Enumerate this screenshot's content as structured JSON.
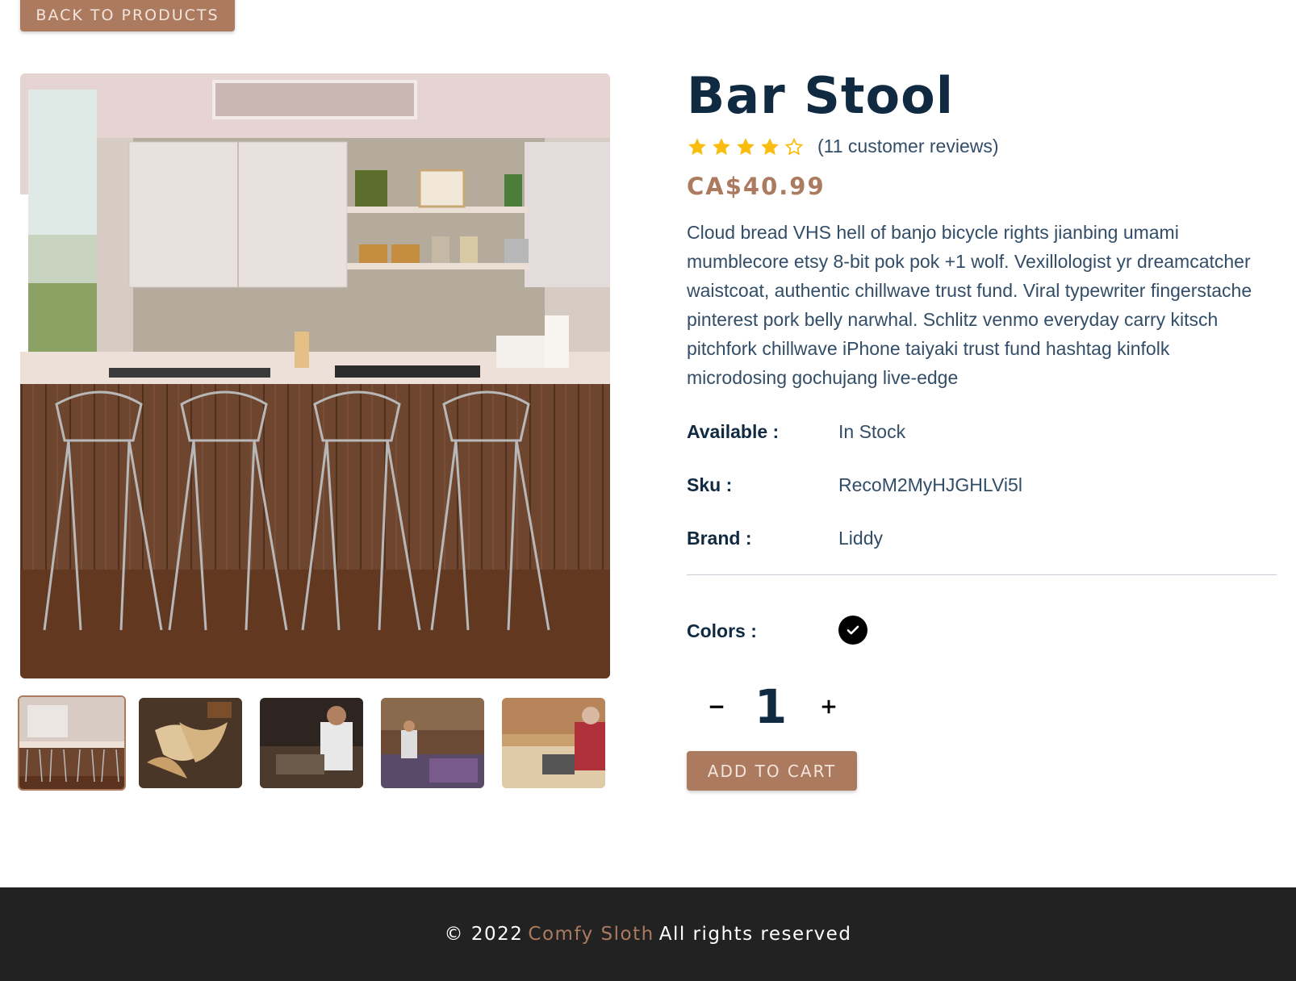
{
  "back_button": {
    "label": "BACK TO PRODUCTS"
  },
  "product": {
    "name": "Bar Stool",
    "rating": 4,
    "rating_max": 5,
    "reviews_text": "(11 customer reviews)",
    "price": "CA$40.99",
    "description": "Cloud bread VHS hell of banjo bicycle rights jianbing umami mumblecore etsy 8-bit pok pok +1 wolf. Vexillologist yr dreamcatcher waistcoat, authentic chillwave trust fund. Viral typewriter fingerstache pinterest pork belly narwhal. Schlitz venmo everyday carry kitsch pitchfork chillwave iPhone taiyaki trust fund hashtag kinfolk microdosing gochujang live-edge",
    "info": [
      {
        "label": "Available :",
        "value": "In Stock"
      },
      {
        "label": "Sku :",
        "value": "RecoM2MyHJGHLVi5l"
      },
      {
        "label": "Brand :",
        "value": "Liddy"
      }
    ],
    "colors_label": "Colors :",
    "colors": [
      "#000000"
    ],
    "quantity": "1",
    "add_to_cart_label": "ADD TO CART"
  },
  "gallery": {
    "main_image": "kitchen-bar-stools-photo",
    "thumbnails": [
      "kitchen-bar-stools-thumb",
      "wood-shavings-thumb",
      "woodworker-thumb",
      "workshop-thumb",
      "carpenter-laptop-thumb"
    ],
    "active_index": 0
  },
  "footer": {
    "copyright": "© 2022",
    "brand": "Comfy Sloth",
    "rights": "All rights reserved"
  },
  "colors": {
    "accent": "#ab7a5f",
    "heading": "#102a42",
    "text": "#324d67",
    "star": "#f9bd12",
    "footer_bg": "#222222"
  }
}
